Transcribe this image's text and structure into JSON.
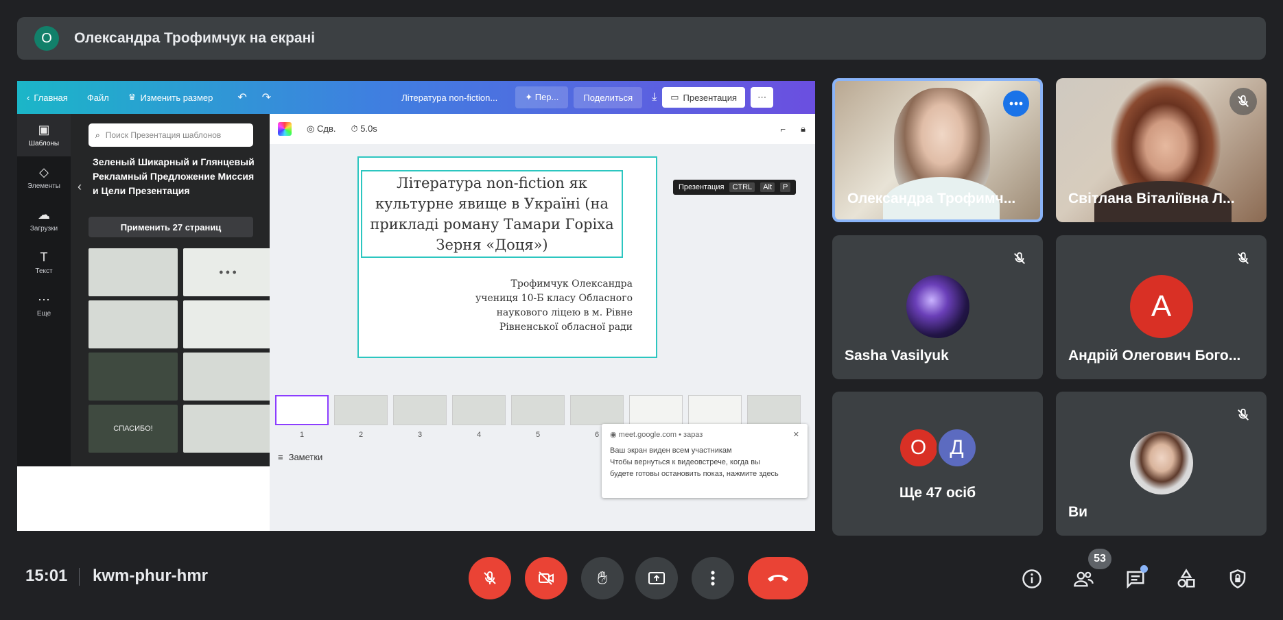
{
  "banner": {
    "avatar_letter": "О",
    "title": "Олександра Трофимчук на екрані"
  },
  "canva": {
    "topbar": {
      "home": "Главная",
      "file": "Файл",
      "resize": "Изменить размер",
      "doc_title": "Література non-fiction...",
      "share_btn_short": "Пер...",
      "share": "Поделиться",
      "present": "Презентация"
    },
    "rail": [
      {
        "label": "Шаблоны",
        "icon": "templates-icon"
      },
      {
        "label": "Элементы",
        "icon": "elements-icon"
      },
      {
        "label": "Загрузки",
        "icon": "uploads-icon"
      },
      {
        "label": "Текст",
        "icon": "text-icon"
      },
      {
        "label": "Еще",
        "icon": "more-icon"
      }
    ],
    "panel": {
      "search_placeholder": "Поиск Презентация шаблонов",
      "template_name": "Зеленый Шикарный и Глянцевый Рекламный Предложение Миссия и Цели Презентация",
      "apply": "Применить 27 страниц",
      "thumb_thanks": "СПАСИБО!"
    },
    "toolbar": {
      "anim": "Сдв.",
      "duration": "5.0s"
    },
    "slide": {
      "title": "Література non-fiction як культурне явище в Україні (на прикладі роману Тамари Горіха Зерня «Доця»)",
      "author_lines": [
        "Трофимчук Олександра",
        "учениця 10-Б класу Обласного",
        "наукового ліцею в м. Рівне",
        "Рівненської обласної ради"
      ]
    },
    "tooltip": {
      "label": "Презентация",
      "keys": [
        "CTRL",
        "Alt",
        "P"
      ]
    },
    "film_pages": [
      "1",
      "2",
      "3",
      "4",
      "5",
      "6"
    ],
    "notes": "Заметки",
    "toast": {
      "source": "meet.google.com",
      "time": "зараз",
      "line1": "Ваш экран виден всем участникам",
      "line2": "Чтобы вернуться к видеовстрече, когда вы будете готовы остановить показ, нажмите здесь"
    }
  },
  "tiles": {
    "t1": {
      "name": "Олександра Трофимч..."
    },
    "t2": {
      "name": "Світлана Віталіївна Л..."
    },
    "t3": {
      "name": "Sasha Vasilyuk"
    },
    "t4": {
      "name": "Андрій Олегович Бого...",
      "letter": "А"
    },
    "t5": {
      "letters": [
        "О",
        "Д"
      ],
      "label": "Ще 47 осіб"
    },
    "t6": {
      "name": "Ви"
    }
  },
  "bottom": {
    "time": "15:01",
    "meeting_code": "kwm-phur-hmr",
    "people_count": "53"
  },
  "colors": {
    "accent": "#8ab4f8",
    "danger": "#ea4335",
    "background": "#202124",
    "tile": "#3c4043"
  }
}
